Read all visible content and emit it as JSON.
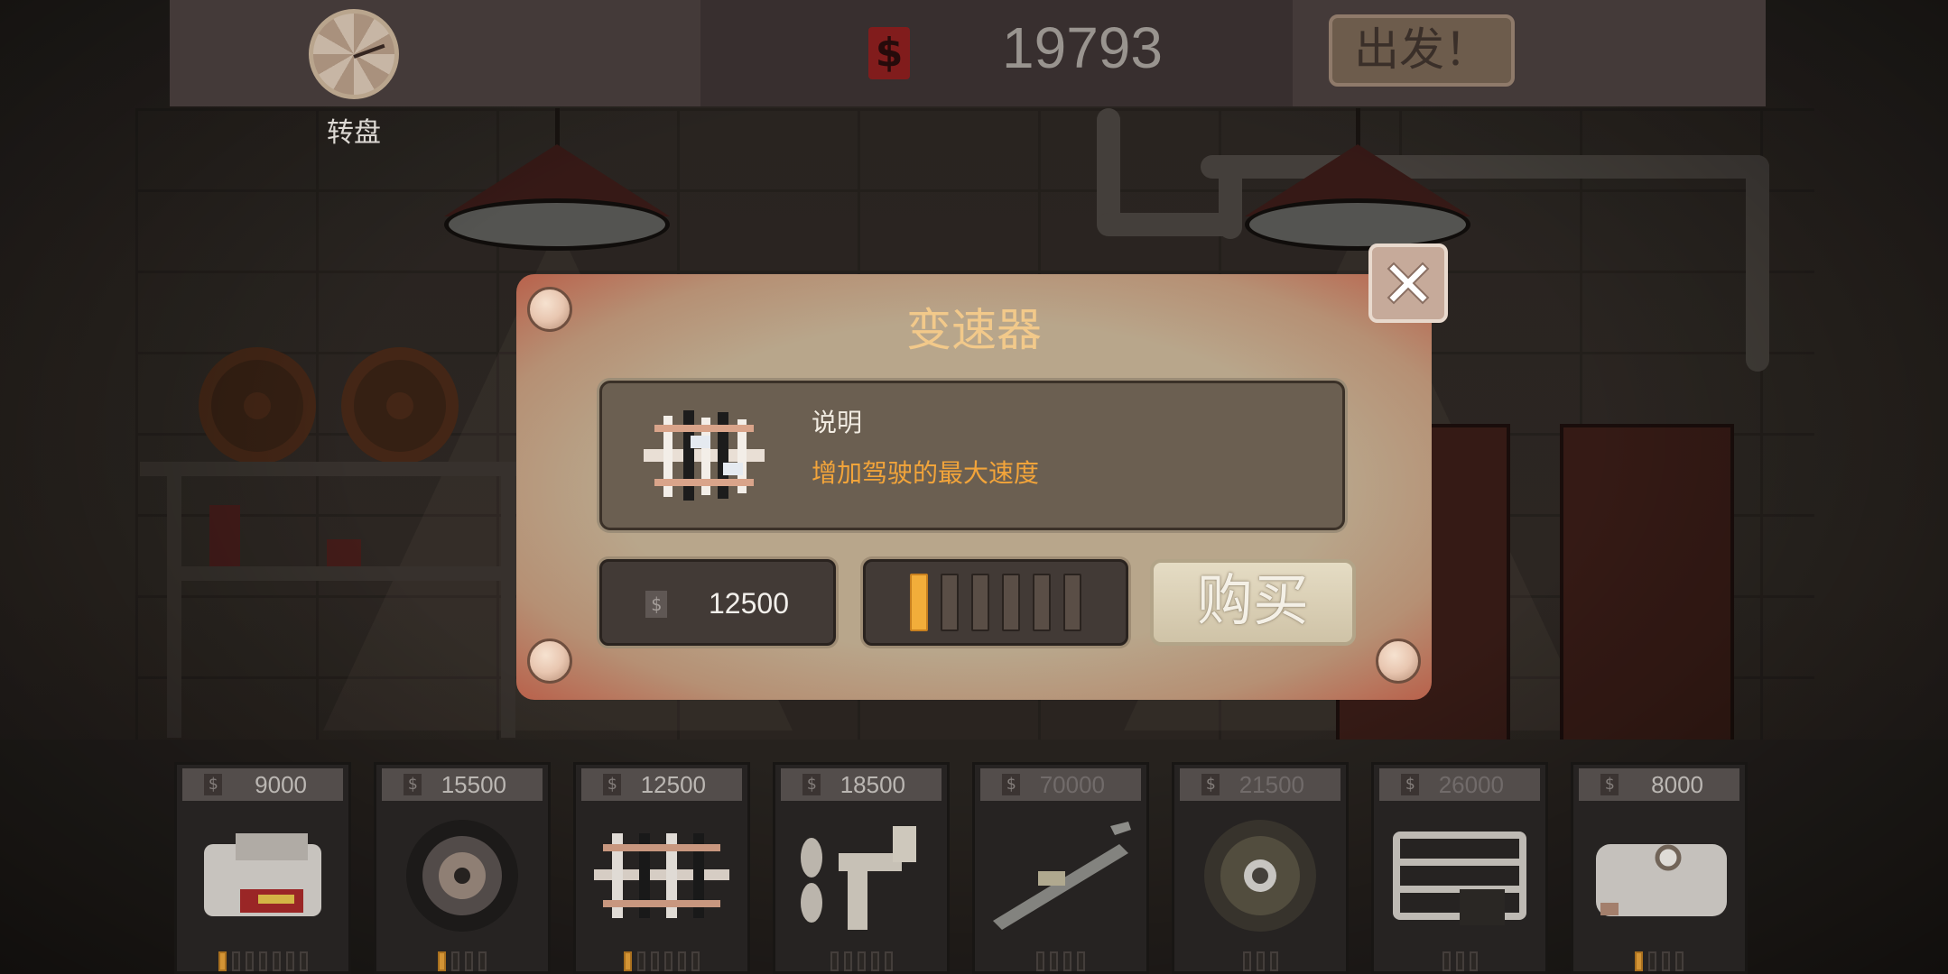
{
  "top_bar": {
    "wheel_label": "转盘",
    "cash_icon": "$",
    "cash": "19793",
    "go_label": "出发！"
  },
  "dialog": {
    "title": "变速器",
    "part_icon": "gearbox-icon",
    "description_label": "说明",
    "description_text": "增加驾驶的最大速度",
    "price_icon": "$",
    "price": "12500",
    "upgrade_level": 1,
    "upgrade_max": 6,
    "buy_label": "购买",
    "close_icon": "close-icon"
  },
  "shop_items": [
    {
      "icon": "engine-icon",
      "price": "9000",
      "level": 1,
      "max": 7,
      "dimmed": false
    },
    {
      "icon": "tire-icon",
      "price": "15500",
      "level": 1,
      "max": 4,
      "dimmed": false
    },
    {
      "icon": "gearbox-icon",
      "price": "12500",
      "level": 1,
      "max": 6,
      "dimmed": false
    },
    {
      "icon": "steering-icon",
      "price": "18500",
      "level": 0,
      "max": 5,
      "dimmed": false
    },
    {
      "icon": "rifle-icon",
      "price": "70000",
      "level": 0,
      "max": 4,
      "dimmed": true
    },
    {
      "icon": "armor-plate-icon",
      "price": "21500",
      "level": 0,
      "max": 3,
      "dimmed": true
    },
    {
      "icon": "cage-icon",
      "price": "26000",
      "level": 0,
      "max": 3,
      "dimmed": true
    },
    {
      "icon": "fuel-tank-icon",
      "price": "8000",
      "level": 1,
      "max": 4,
      "dimmed": false
    }
  ],
  "colors": {
    "accent": "#f2ad3a",
    "title": "#f2c98a",
    "panel": "#6b5f51",
    "cash_icon": "#8c1f1f"
  }
}
